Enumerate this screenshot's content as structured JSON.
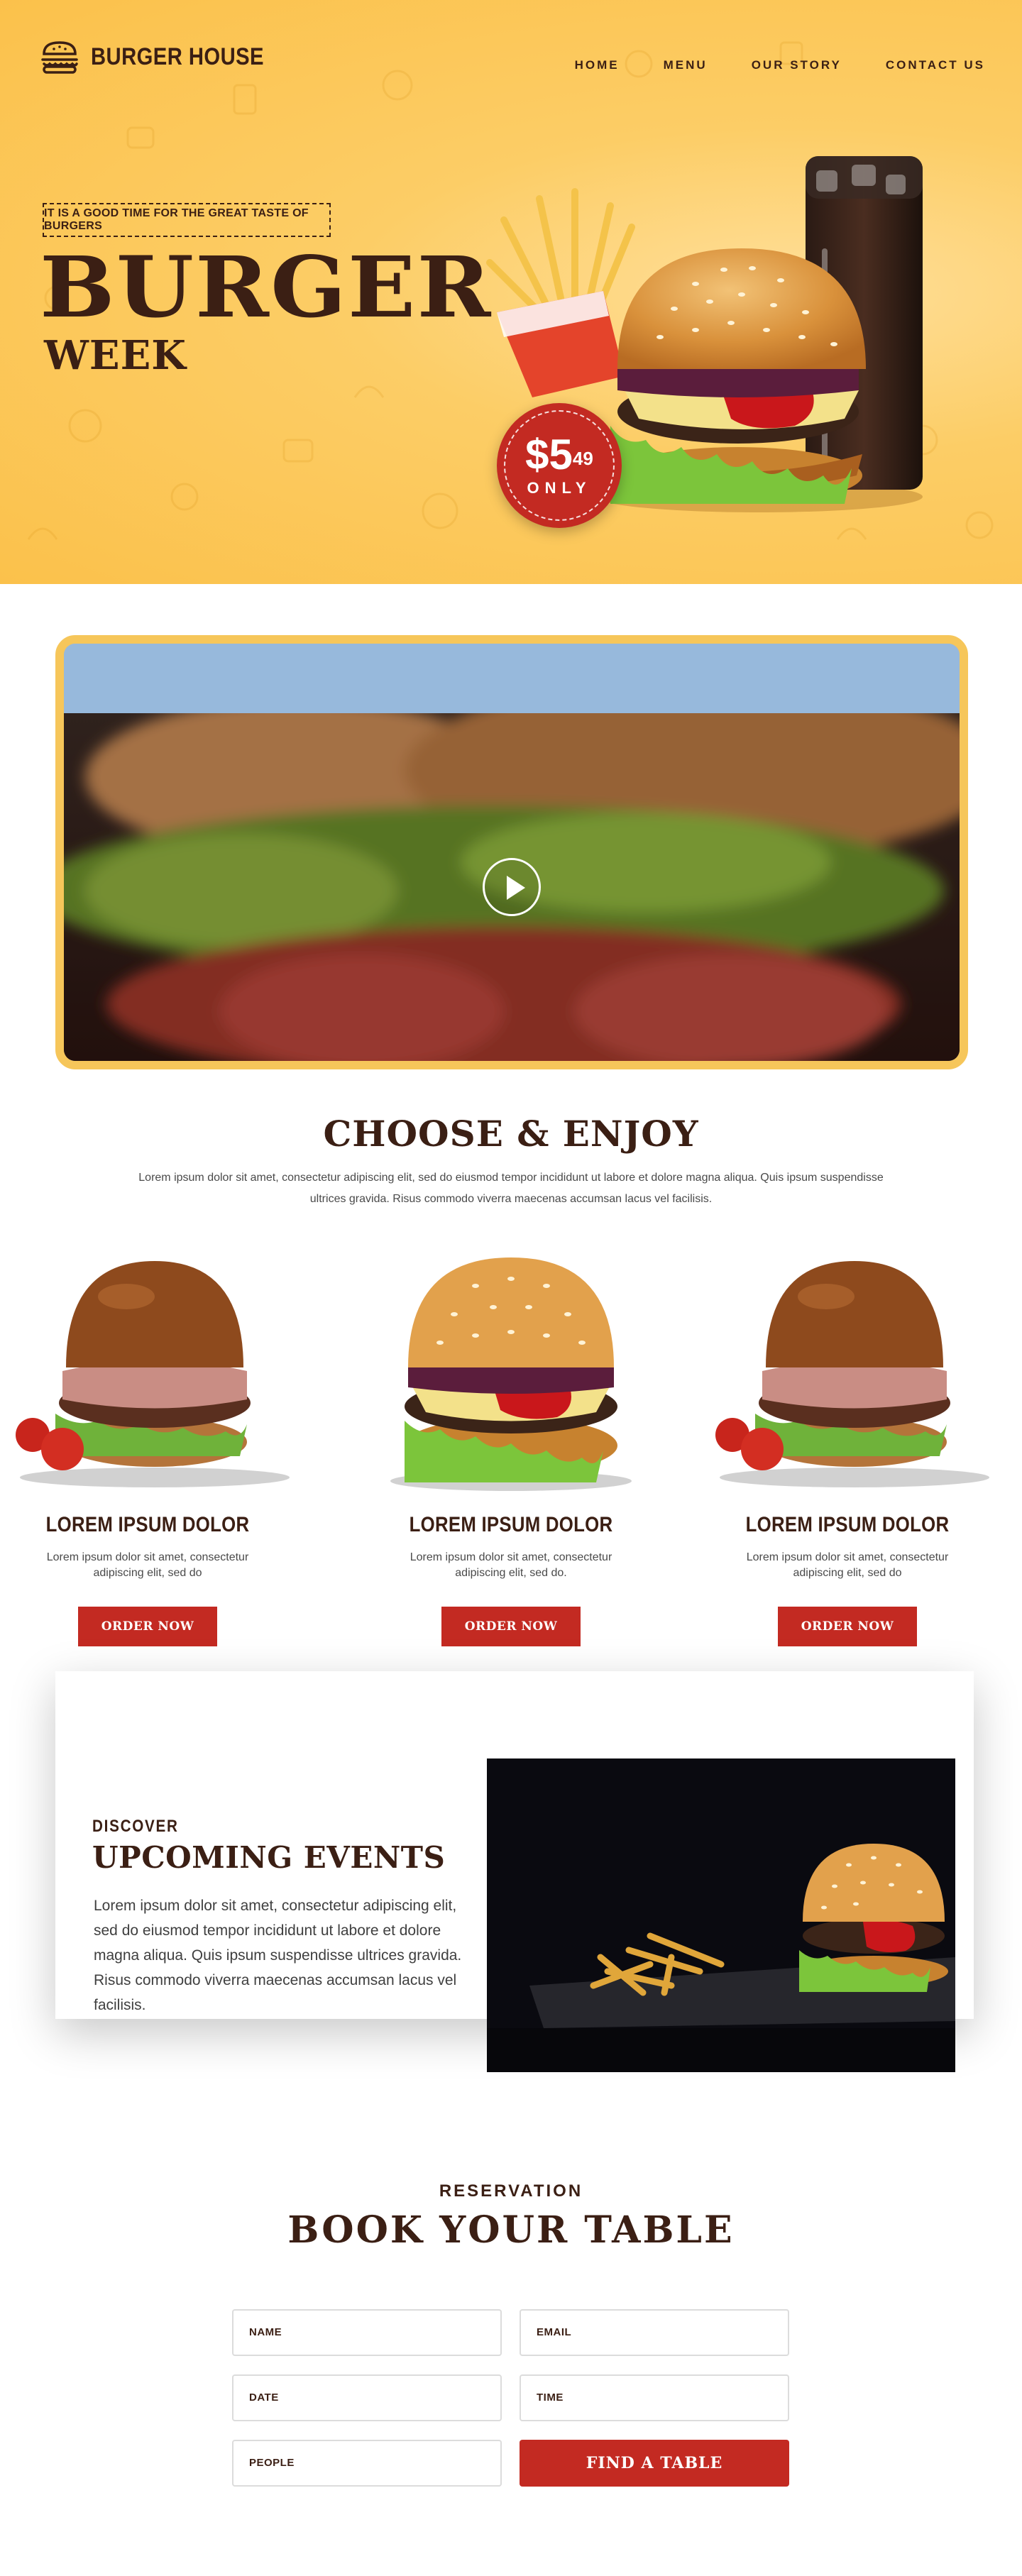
{
  "header": {
    "brand": "BURGER HOUSE",
    "nav": [
      "HOME",
      "MENU",
      "OUR STORY",
      "CONTACT US"
    ]
  },
  "hero": {
    "tagline": "IT IS A GOOD TIME FOR THE GREAT TASTE OF BURGERS",
    "title": "BURGER",
    "subtitle": "WEEK",
    "price_main": "$5",
    "price_cents": "49",
    "price_only": "ONLY"
  },
  "choose": {
    "title": "CHOOSE & ENJOY",
    "description": "Lorem ipsum dolor sit amet, consectetur adipiscing elit, sed do eiusmod tempor incididunt ut labore et dolore magna aliqua. Quis ipsum suspendisse ultrices gravida. Risus commodo viverra maecenas accumsan lacus vel facilisis.",
    "products": [
      {
        "name": "LOREM IPSUM DOLOR",
        "desc": "Lorem ipsum dolor sit amet, consectetur adipiscing elit, sed do",
        "button": "ORDER NOW"
      },
      {
        "name": "LOREM IPSUM DOLOR",
        "desc": "Lorem ipsum dolor sit amet, consectetur adipiscing elit, sed do.",
        "button": "ORDER NOW"
      },
      {
        "name": "LOREM IPSUM DOLOR",
        "desc": "Lorem ipsum dolor sit amet, consectetur adipiscing elit, sed do",
        "button": "ORDER NOW"
      }
    ]
  },
  "events": {
    "kicker": "DISCOVER",
    "title": "UPCOMING EVENTS",
    "body": "Lorem ipsum dolor sit amet, consectetur adipiscing elit, sed do eiusmod tempor incididunt ut labore et dolore magna aliqua. Quis ipsum suspendisse ultrices gravida. Risus commodo viverra maecenas accumsan lacus vel facilisis."
  },
  "reservation": {
    "kicker": "RESERVATION",
    "title": "BOOK YOUR TABLE",
    "fields": {
      "name": "NAME",
      "email": "EMAIL",
      "date": "DATE",
      "time": "TIME",
      "people": "PEOPLE"
    },
    "submit": "FIND A TABLE"
  },
  "colors": {
    "brand_brown": "#3b1f14",
    "accent_red": "#c32a22",
    "hero_yellow": "#fbc14b",
    "frame_yellow": "#f6c65a"
  },
  "icons": [
    "burger-icon",
    "play-icon"
  ]
}
